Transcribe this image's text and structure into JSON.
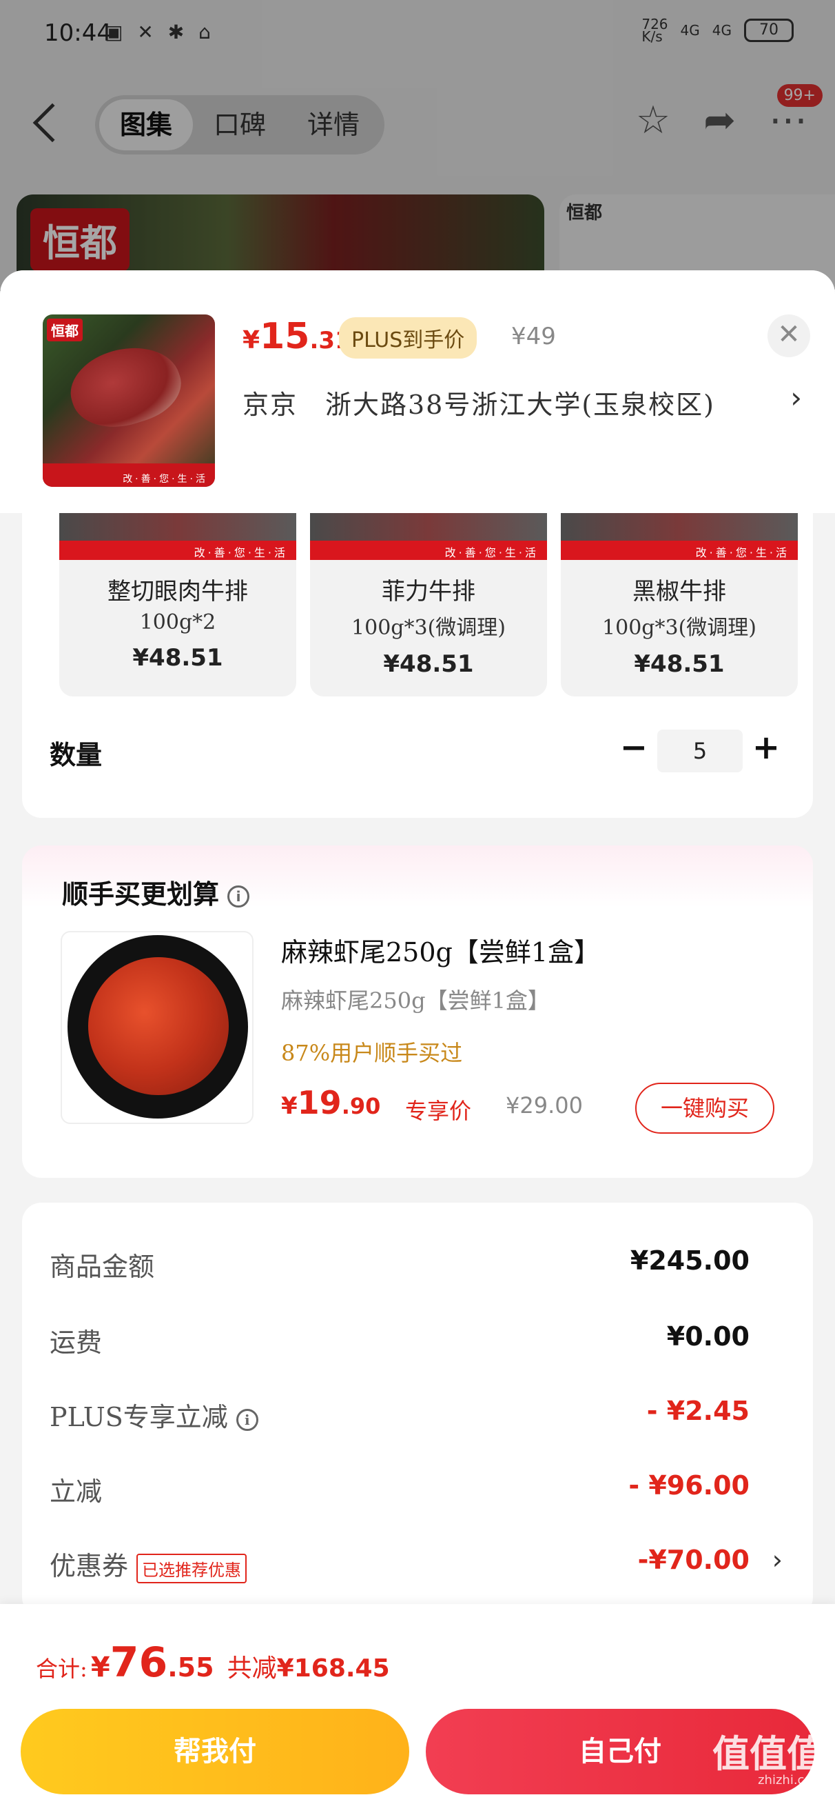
{
  "status_bar": {
    "time": "10:44",
    "net_speed": "726\nK/s",
    "signal1": "4G",
    "signal2": "4G",
    "battery": "70"
  },
  "nav": {
    "tabs": [
      "图集",
      "口碑",
      "详情"
    ],
    "badge": "99+"
  },
  "background": {
    "brand": "恒都"
  },
  "product": {
    "brand": "恒都",
    "price_currency": "¥",
    "price_int": "15",
    "price_dec": ".31",
    "plus_tag": "PLUS到手价",
    "original_price": "¥49",
    "address": "京京　浙大路38号浙江大学(玉泉校区)",
    "image_strip": "改·善·您·生·活"
  },
  "variants": [
    {
      "name": "整切眼肉牛排",
      "weight": "100g*2",
      "price": "¥48.51",
      "strip": "改·善·您·生·活"
    },
    {
      "name": "菲力牛排",
      "weight": "100g*3(微调理)",
      "price": "¥48.51",
      "strip": "改·善·您·生·活"
    },
    {
      "name": "黑椒牛排",
      "weight": "100g*3(微调理)",
      "price": "¥48.51",
      "strip": "改·善·您·生·活"
    }
  ],
  "quantity": {
    "label": "数量",
    "value": "5",
    "minus": "−",
    "plus": "+"
  },
  "addon": {
    "title": "顺手买更划算",
    "name": "麻辣虾尾250g【尝鲜1盒】",
    "subtitle": "麻辣虾尾250g【尝鲜1盒】",
    "stat": "87%用户顺手买过",
    "price_currency": "¥",
    "price_int": "19",
    "price_dec": ".90",
    "price_tag": "专享价",
    "original_price": "¥29.00",
    "buy_button": "一键购买"
  },
  "summary": {
    "rows": [
      {
        "label": "商品金额",
        "value": "¥245.00"
      },
      {
        "label": "运费",
        "value": "¥0.00"
      },
      {
        "label": "PLUS专享立减",
        "value": "- ¥2.45"
      },
      {
        "label": "立减",
        "value": "- ¥96.00"
      },
      {
        "label": "优惠券",
        "value": "-¥70.00",
        "tag": "已选推荐优惠"
      }
    ]
  },
  "bottom": {
    "total_label": "合计:",
    "total_currency": "¥",
    "total_int": "76",
    "total_dec": ".55",
    "saved_label": "共减",
    "saved_value": "¥168.45",
    "help_pay": "帮我付",
    "self_pay": "自己付"
  },
  "watermark": {
    "text": "值值值",
    "domain": "zhizhi.com"
  },
  "colors": {
    "accent_red": "#e1251b",
    "yellow_button": "#ffb21a",
    "red_button": "#e8293a",
    "plus_tag_bg": "#fbe7b6"
  }
}
